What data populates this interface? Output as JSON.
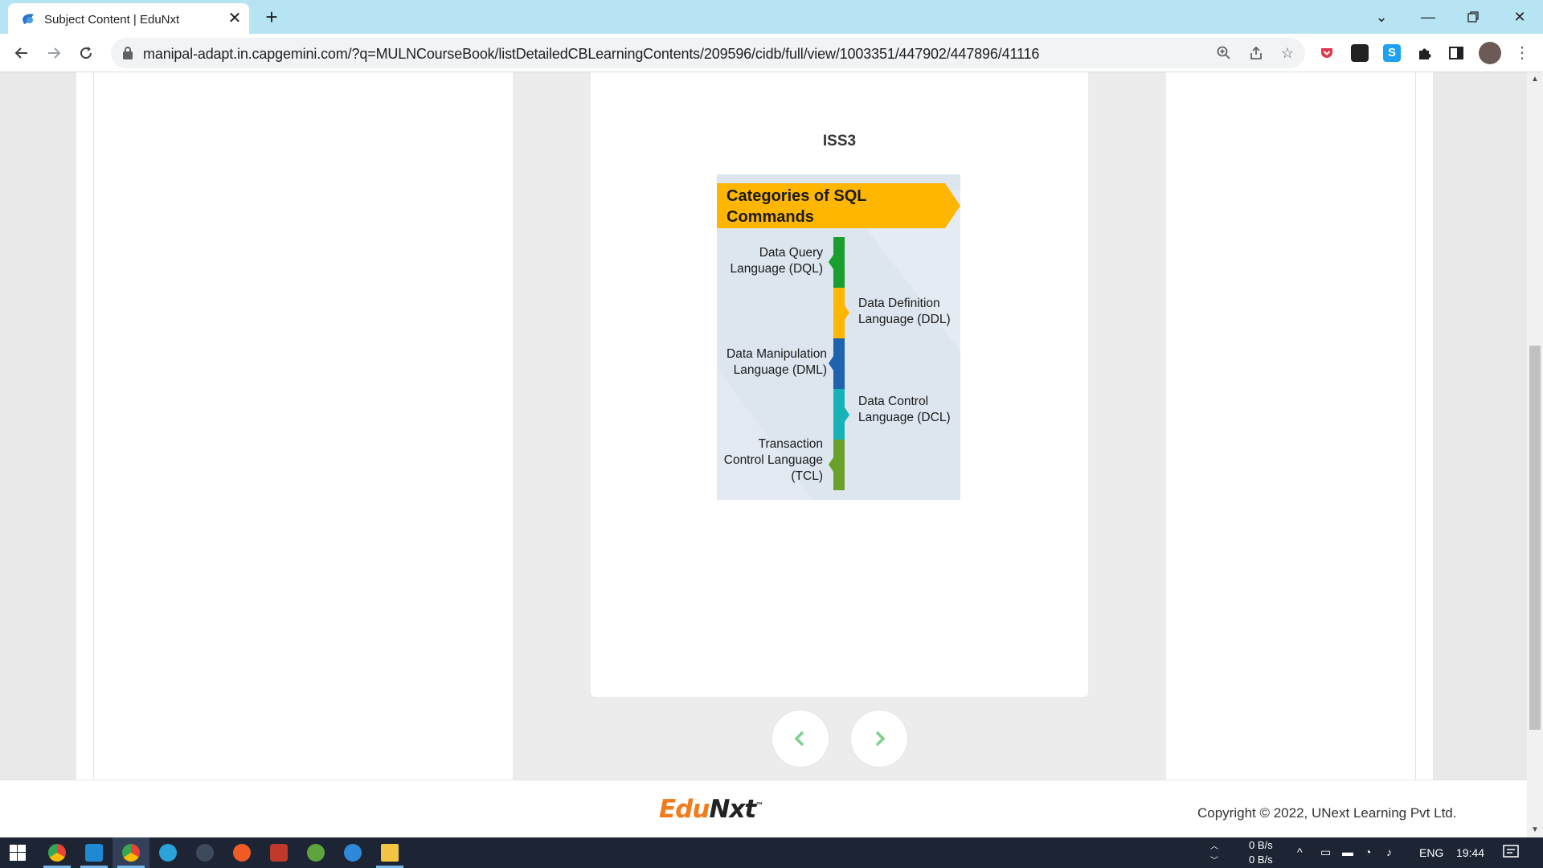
{
  "browser": {
    "tab_title": "Subject Content | EduNxt",
    "url": "manipal-adapt.in.capgemini.com/?q=MULNCourseBook/listDetailedCBLearningContents/209596/cidb/full/view/1003351/447902/447896/41116"
  },
  "content": {
    "card_title": "ISS3",
    "diagram": {
      "banner": "Categories of SQL Commands",
      "items": [
        {
          "label": "Data Query Language (DQL)",
          "color": "#1a9e2e"
        },
        {
          "label": "Data Definition Language (DDL)",
          "color": "#ffb600"
        },
        {
          "label": "Data Manipulation Language (DML)",
          "color": "#1e62b0"
        },
        {
          "label": "Data Control Language (DCL)",
          "color": "#17b3b8"
        },
        {
          "label": "Transaction Control Language (TCL)",
          "color": "#6aa12a"
        }
      ],
      "banner_color": "#ffb600"
    }
  },
  "nav": {
    "prev_icon": "chevron-left-icon",
    "next_icon": "chevron-right-icon",
    "accent": "#7ed08c"
  },
  "footer": {
    "logo_part1": "Edu",
    "logo_part2": "Nxt",
    "logo_tm": "™",
    "copyright": "Copyright © 2022, UNext Learning Pvt Ltd."
  },
  "taskbar": {
    "net_up": "0 B/s",
    "net_down": "0 B/s",
    "language": "ENG",
    "time": "19:44"
  }
}
